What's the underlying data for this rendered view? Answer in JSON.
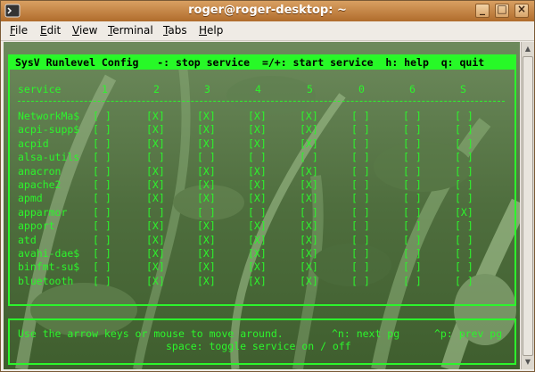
{
  "window": {
    "title": "roger@roger-desktop: ~"
  },
  "menu": [
    {
      "label": "File",
      "key": "F",
      "rest": "ile"
    },
    {
      "label": "Edit",
      "key": "E",
      "rest": "dit"
    },
    {
      "label": "View",
      "key": "V",
      "rest": "iew"
    },
    {
      "label": "Terminal",
      "key": "T",
      "rest": "erminal"
    },
    {
      "label": "Tabs",
      "key": "T",
      "rest": "abs"
    },
    {
      "label": "Help",
      "key": "H",
      "rest": "elp"
    }
  ],
  "header": "SysV Runlevel Config   -: stop service  =/+: start service  h: help  q: quit",
  "columns": [
    "service",
    "1",
    "2",
    "3",
    "4",
    "5",
    "0",
    "6",
    "S"
  ],
  "services": [
    {
      "name": "NetworkMa$",
      "states": [
        "[ ]",
        "[X]",
        "[X]",
        "[X]",
        "[X]",
        "[ ]",
        "[ ]",
        "[ ]"
      ]
    },
    {
      "name": "acpi-supp$",
      "states": [
        "[ ]",
        "[X]",
        "[X]",
        "[X]",
        "[X]",
        "[ ]",
        "[ ]",
        "[ ]"
      ]
    },
    {
      "name": "acpid",
      "states": [
        "[ ]",
        "[X]",
        "[X]",
        "[X]",
        "[X]",
        "[ ]",
        "[ ]",
        "[ ]"
      ]
    },
    {
      "name": "alsa-utils",
      "states": [
        "[ ]",
        "[ ]",
        "[ ]",
        "[ ]",
        "[ ]",
        "[ ]",
        "[ ]",
        "[ ]"
      ]
    },
    {
      "name": "anacron",
      "states": [
        "[ ]",
        "[X]",
        "[X]",
        "[X]",
        "[X]",
        "[ ]",
        "[ ]",
        "[ ]"
      ]
    },
    {
      "name": "apache2",
      "states": [
        "[ ]",
        "[X]",
        "[X]",
        "[X]",
        "[X]",
        "[ ]",
        "[ ]",
        "[ ]"
      ]
    },
    {
      "name": "apmd",
      "states": [
        "[ ]",
        "[X]",
        "[X]",
        "[X]",
        "[X]",
        "[ ]",
        "[ ]",
        "[ ]"
      ]
    },
    {
      "name": "apparmor",
      "states": [
        "[ ]",
        "[ ]",
        "[ ]",
        "[ ]",
        "[ ]",
        "[ ]",
        "[ ]",
        "[X]"
      ]
    },
    {
      "name": "apport",
      "states": [
        "[ ]",
        "[X]",
        "[X]",
        "[X]",
        "[X]",
        "[ ]",
        "[ ]",
        "[ ]"
      ]
    },
    {
      "name": "atd",
      "states": [
        "[ ]",
        "[X]",
        "[X]",
        "[X]",
        "[X]",
        "[ ]",
        "[ ]",
        "[ ]"
      ]
    },
    {
      "name": "avahi-dae$",
      "states": [
        "[ ]",
        "[X]",
        "[X]",
        "[X]",
        "[X]",
        "[ ]",
        "[ ]",
        "[ ]"
      ]
    },
    {
      "name": "binfmt-su$",
      "states": [
        "[ ]",
        "[X]",
        "[X]",
        "[X]",
        "[X]",
        "[ ]",
        "[ ]",
        "[ ]"
      ]
    },
    {
      "name": "bluetooth",
      "states": [
        "[ ]",
        "[X]",
        "[X]",
        "[X]",
        "[X]",
        "[ ]",
        "[ ]",
        "[ ]"
      ]
    }
  ],
  "footer": {
    "line1_left": "Use the arrow keys or mouse to move around.",
    "line1_mid": "^n: next pg",
    "line1_right": "^p: prev pg",
    "line2": "space: toggle service on / off"
  },
  "colors": {
    "terminal_green": "#2cf52c",
    "titlebar": "#c07a38"
  }
}
